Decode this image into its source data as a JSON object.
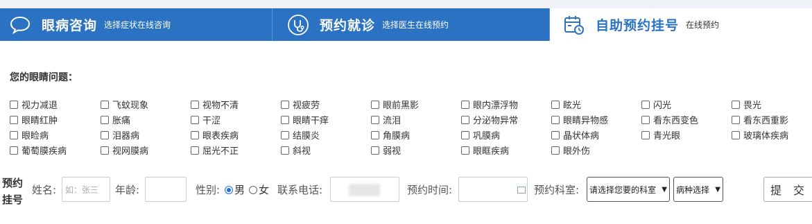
{
  "tabs": [
    {
      "title": "眼病咨询",
      "subtitle": "选择症状在线咨询",
      "icon": "speech-bubble-icon"
    },
    {
      "title": "预约就诊",
      "subtitle": "选择医生在线预约",
      "icon": "stethoscope-icon"
    },
    {
      "title": "自助预约挂号",
      "subtitle": "在线预约",
      "icon": "calendar-clock-icon"
    }
  ],
  "question_title": "您的眼睛问题：",
  "symptoms": [
    "视力减退",
    "飞蚊现象",
    "视物不清",
    "视疲劳",
    "眼前黑影",
    "眼内漂浮物",
    "眩光",
    "闪光",
    "畏光",
    "眼睛红肿",
    "胀痛",
    "干涩",
    "眼睛干痒",
    "流泪",
    "分泌物异常",
    "眼睛异物感",
    "看东西变色",
    "看东西重影",
    "眼睑病",
    "泪器病",
    "眼表疾病",
    "结膜炎",
    "角膜病",
    "巩膜病",
    "晶状体病",
    "青光眼",
    "玻璃体疾病",
    "葡萄膜疾病",
    "视网膜病",
    "屈光不正",
    "斜视",
    "弱视",
    "眼眶疾病",
    "眼外伤"
  ],
  "form": {
    "section_label": "预约挂号",
    "name_label": "姓名:",
    "name_placeholder": "如：张三",
    "age_label": "年龄:",
    "gender_label": "性别:",
    "gender_male": "男",
    "gender_female": "女",
    "gender_selected": "男",
    "phone_label": "联系电话:",
    "time_label": "预约时间:",
    "dept_label": "预约科室:",
    "dept_select": "请选择您要的科室",
    "disease_select": "病种选择",
    "submit": "提 交"
  },
  "colors": {
    "tab_blue": "#2b72c2",
    "tab_active_text": "#2b72c2"
  }
}
